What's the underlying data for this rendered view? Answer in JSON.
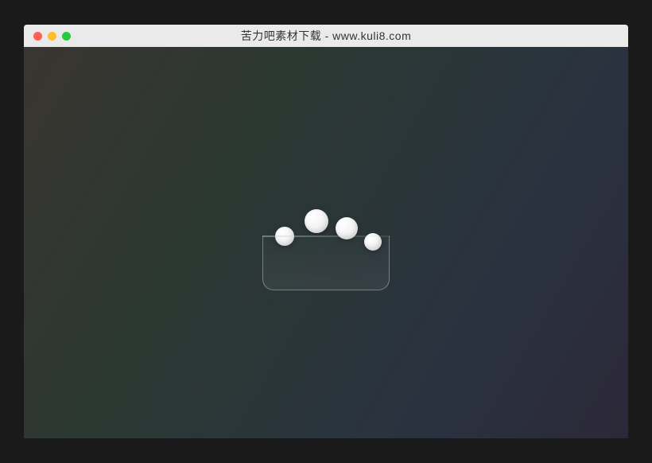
{
  "window": {
    "title": "苦力吧素材下载 - www.kuli8.com"
  },
  "traffic_lights": {
    "close_color": "#ff5f56",
    "minimize_color": "#ffbd2e",
    "zoom_color": "#27c93f"
  },
  "loader": {
    "type": "bouncing-balls-into-cup",
    "ball_count": 4
  }
}
